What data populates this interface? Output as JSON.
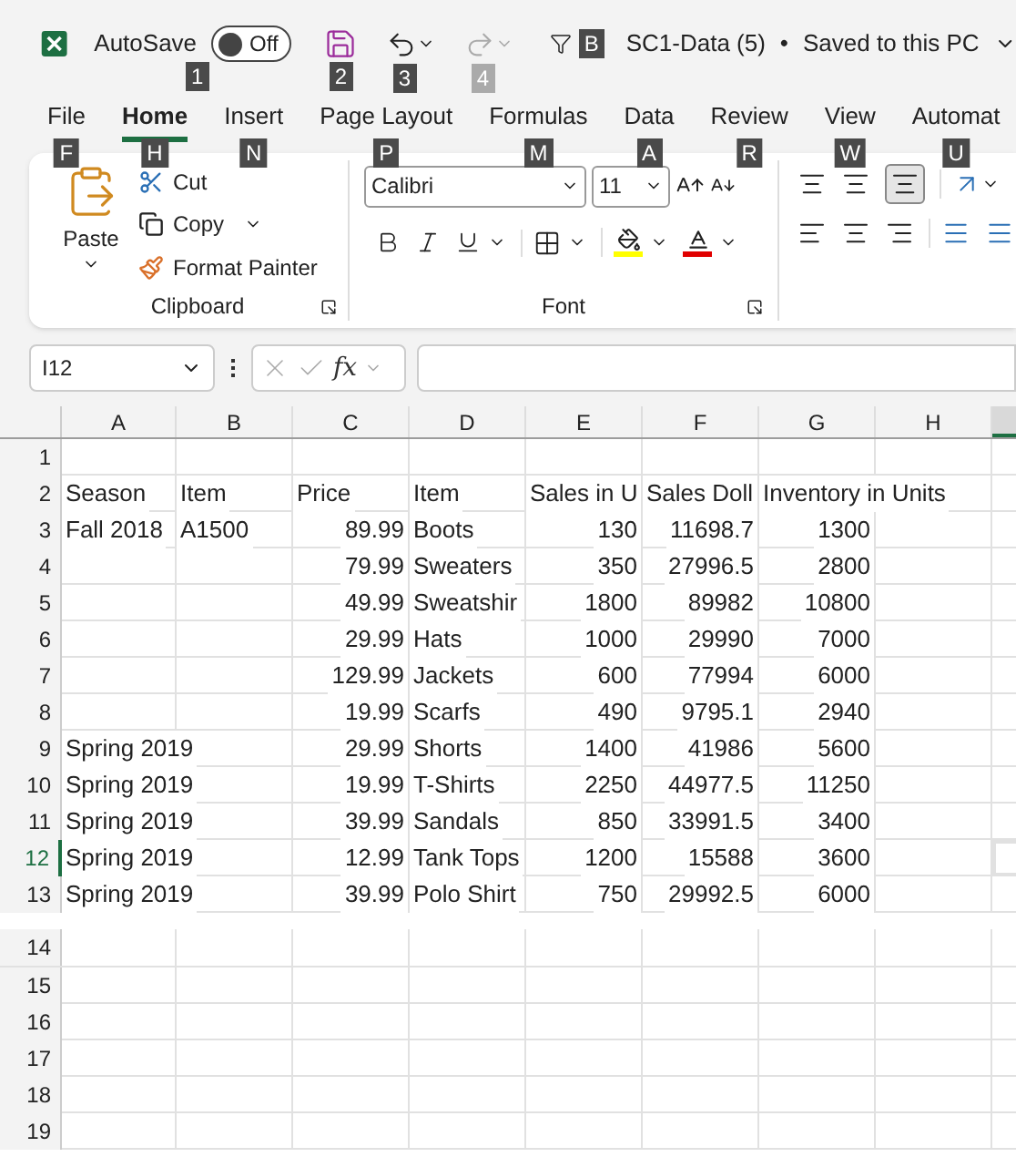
{
  "title_bar": {
    "autosave_label": "AutoSave",
    "autosave": {
      "on": false,
      "label": "Off",
      "keytip": "1"
    },
    "save_keytip": "2",
    "undo_keytip": "3",
    "redo_keytip": "4",
    "customize_keytip": "B",
    "document_title": "SC1-Data (5)",
    "separator": "•",
    "save_status": "Saved to this PC"
  },
  "tabs": [
    {
      "label": "File",
      "keytip": "F",
      "selected": false
    },
    {
      "label": "Home",
      "keytip": "H",
      "selected": true
    },
    {
      "label": "Insert",
      "keytip": "N",
      "selected": false
    },
    {
      "label": "Page Layout",
      "keytip": "P",
      "selected": false
    },
    {
      "label": "Formulas",
      "keytip": "M",
      "selected": false
    },
    {
      "label": "Data",
      "keytip": "A",
      "selected": false
    },
    {
      "label": "Review",
      "keytip": "R",
      "selected": false
    },
    {
      "label": "View",
      "keytip": "W",
      "selected": false
    },
    {
      "label": "Automat",
      "keytip": "U",
      "selected": false
    }
  ],
  "ribbon": {
    "clipboard": {
      "paste": "Paste",
      "cut": "Cut",
      "copy": "Copy",
      "format_painter": "Format Painter",
      "label": "Clipboard"
    },
    "font": {
      "font_name": "Calibri",
      "font_size": "11",
      "label": "Font"
    }
  },
  "formula_bar": {
    "name_box": "I12",
    "function_label": "fx"
  },
  "columns": [
    {
      "label": "A",
      "numeric": false,
      "selected": false
    },
    {
      "label": "B",
      "numeric": false,
      "selected": false
    },
    {
      "label": "C",
      "numeric": true,
      "selected": false
    },
    {
      "label": "D",
      "numeric": false,
      "selected": false
    },
    {
      "label": "E",
      "numeric": true,
      "selected": false
    },
    {
      "label": "F",
      "numeric": true,
      "selected": false
    },
    {
      "label": "G",
      "numeric": true,
      "selected": false
    },
    {
      "label": "H",
      "numeric": false,
      "selected": false
    },
    {
      "selected": true
    }
  ],
  "rows": [
    {
      "number": "1",
      "kind": "data",
      "selected": false,
      "cells": []
    },
    {
      "number": "2",
      "kind": "header",
      "selected": false,
      "cells": [
        "Season",
        "Item",
        "Price",
        "Item",
        "Sales in U",
        "Sales Doll",
        "Inventory in Units"
      ]
    },
    {
      "number": "3",
      "kind": "data",
      "selected": false,
      "cells": [
        "Fall 2018",
        "A1500",
        "89.99",
        "Boots",
        "130",
        "11698.7",
        "1300"
      ]
    },
    {
      "number": "4",
      "kind": "data",
      "selected": false,
      "cells": [
        null,
        null,
        "79.99",
        "Sweaters",
        "350",
        "27996.5",
        "2800"
      ]
    },
    {
      "number": "5",
      "kind": "data",
      "selected": false,
      "cells": [
        null,
        null,
        "49.99",
        "Sweatshir",
        "1800",
        "89982",
        "10800"
      ]
    },
    {
      "number": "6",
      "kind": "data",
      "selected": false,
      "cells": [
        null,
        null,
        "29.99",
        "Hats",
        "1000",
        "29990",
        "7000"
      ]
    },
    {
      "number": "7",
      "kind": "data",
      "selected": false,
      "cells": [
        null,
        null,
        "129.99",
        "Jackets",
        "600",
        "77994",
        "6000"
      ]
    },
    {
      "number": "8",
      "kind": "data",
      "selected": false,
      "cells": [
        null,
        null,
        "19.99",
        "Scarfs",
        "490",
        "9795.1",
        "2940"
      ]
    },
    {
      "number": "9",
      "kind": "data",
      "selected": false,
      "cells": [
        "Spring 2019",
        null,
        "29.99",
        "Shorts",
        "1400",
        "41986",
        "5600"
      ]
    },
    {
      "number": "10",
      "kind": "data",
      "selected": false,
      "cells": [
        "Spring 2019",
        null,
        "19.99",
        "T-Shirts",
        "2250",
        "44977.5",
        "11250"
      ]
    },
    {
      "number": "11",
      "kind": "data",
      "selected": false,
      "cells": [
        "Spring 2019",
        null,
        "39.99",
        "Sandals",
        "850",
        "33991.5",
        "3400"
      ]
    },
    {
      "number": "12",
      "kind": "data",
      "selected": true,
      "cells": [
        "Spring 2019",
        null,
        "12.99",
        "Tank Tops",
        "1200",
        "15588",
        "3600"
      ]
    },
    {
      "number": "13",
      "kind": "data",
      "selected": false,
      "cells": [
        "Spring 2019",
        null,
        "39.99",
        "Polo Shirt",
        "750",
        "29992.5",
        "6000"
      ]
    },
    {
      "number": "14",
      "kind": "data",
      "selected": false,
      "cells": []
    },
    {
      "number": "15",
      "kind": "data",
      "selected": false,
      "cells": []
    },
    {
      "number": "16",
      "kind": "data",
      "selected": false,
      "cells": []
    },
    {
      "number": "17",
      "kind": "data",
      "selected": false,
      "cells": []
    },
    {
      "number": "18",
      "kind": "data",
      "selected": false,
      "cells": []
    },
    {
      "number": "19",
      "kind": "data",
      "selected": false,
      "cells": []
    }
  ]
}
